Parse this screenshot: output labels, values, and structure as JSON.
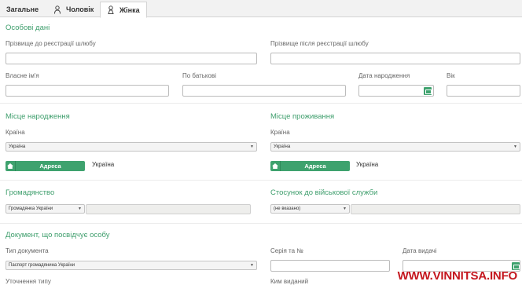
{
  "tabs": [
    {
      "label": "Загальне"
    },
    {
      "label": "Чоловік"
    },
    {
      "label": "Жінка"
    }
  ],
  "personal": {
    "title": "Особові дані",
    "surname_before_label": "Прізвище до реєстрації шлюбу",
    "surname_after_label": "Прізвище після реєстрації шлюбу",
    "first_name_label": "Власне ім'я",
    "patronymic_label": "По батькові",
    "birth_date_label": "Дата народження",
    "age_label": "Вік"
  },
  "birthplace": {
    "title": "Місце народження",
    "country_label": "Країна",
    "country_value": "Україна",
    "address_button": "Адреса",
    "address_value": "Україна"
  },
  "residence": {
    "title": "Місце проживання",
    "country_label": "Країна",
    "country_value": "Україна",
    "address_button": "Адреса",
    "address_value": "Україна"
  },
  "citizenship": {
    "title": "Громадянство",
    "value": "Громадянка України"
  },
  "military": {
    "title": "Стосунок до військової служби",
    "value": "(не вказано)"
  },
  "document": {
    "title": "Документ, що посвідчує особу",
    "type_label": "Тип документа",
    "type_value": "Паспорт громадянина України",
    "series_label": "Серія та №",
    "issue_date_label": "Дата видачі",
    "type_detail_label": "Уточнення типу",
    "issued_by_label": "Ким виданий"
  },
  "watermark": "WWW.VINNITSA.INFO",
  "colors": {
    "accent": "#3ea26e",
    "watermark": "#c4171f"
  },
  "icons": [
    "male-icon",
    "female-icon",
    "home-icon",
    "calendar-icon",
    "dropdown-arrow-icon"
  ]
}
